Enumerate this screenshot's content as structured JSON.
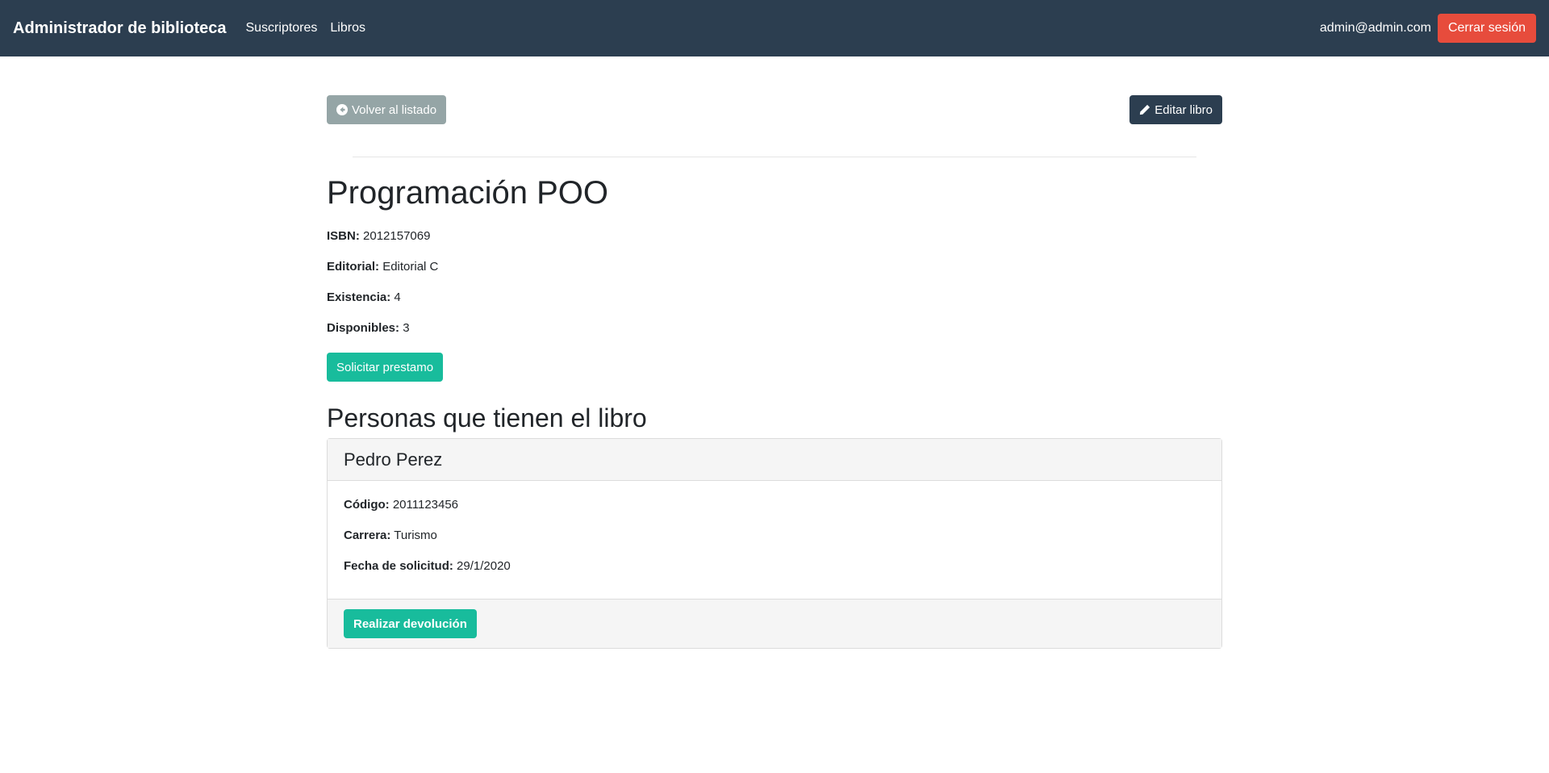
{
  "navbar": {
    "brand": "Administrador de biblioteca",
    "links": [
      "Suscriptores",
      "Libros"
    ],
    "user_email": "admin@admin.com",
    "logout_label": "Cerrar sesión"
  },
  "actions": {
    "back_label": "Volver al listado",
    "back_icon": "arrow-circle-left-icon",
    "edit_label": "Editar libro",
    "edit_icon": "pencil-icon"
  },
  "book": {
    "title": "Programación POO",
    "isbn_label": "ISBN:",
    "isbn": "2012157069",
    "publisher_label": "Editorial:",
    "publisher": "Editorial C",
    "stock_label": "Existencia:",
    "stock": "4",
    "available_label": "Disponibles:",
    "available": "3"
  },
  "request_label": "Solicitar prestamo",
  "holders_title": "Personas que tienen el libro",
  "holders": [
    {
      "name": "Pedro Perez",
      "code_label": "Código:",
      "code": "2011123456",
      "career_label": "Carrera:",
      "career": "Turismo",
      "date_label": "Fecha de solicitud:",
      "date": "29/1/2020",
      "return_label": "Realizar devolución"
    }
  ],
  "colors": {
    "navbar": "#2c3e50",
    "danger": "#e74c3c",
    "success": "#18bc9c",
    "secondary": "#95a5a6"
  }
}
